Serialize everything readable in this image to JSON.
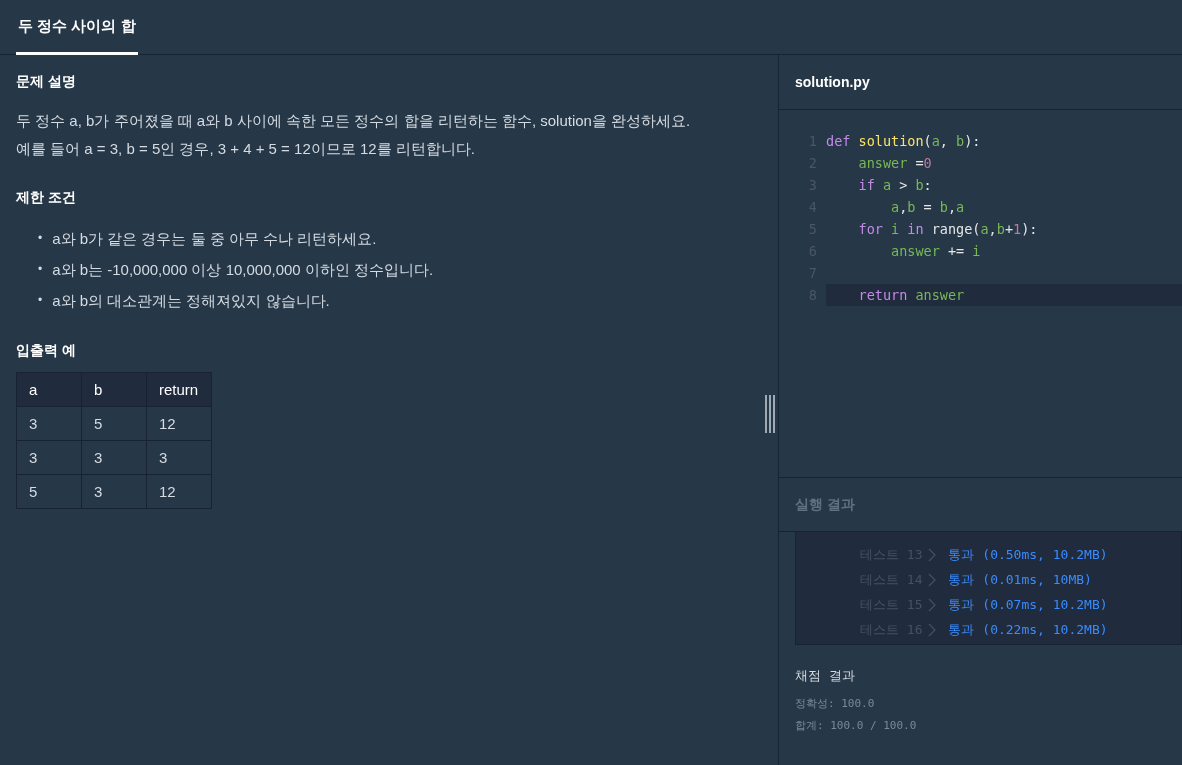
{
  "tabs": [
    {
      "label": "두 정수 사이의 합",
      "selected": true
    }
  ],
  "problem": {
    "sections": [
      {
        "kind": "text",
        "title": "문제 설명",
        "paragraphs": [
          "두 정수 a, b가 주어졌을 때 a와 b 사이에 속한 모든 정수의 합을 리턴하는 함수, solution을 완성하세요.",
          "예를 들어 a = 3, b = 5인 경우, 3 + 4 + 5 = 12이므로 12를 리턴합니다."
        ]
      },
      {
        "kind": "list",
        "title": "제한 조건",
        "bullet": "•",
        "items": [
          "a와 b가 같은 경우는 둘 중 아무 수나 리턴하세요.",
          "a와 b는 -10,000,000 이상 10,000,000 이하인 정수입니다.",
          "a와 b의 대소관계는 정해져있지 않습니다."
        ]
      },
      {
        "kind": "table",
        "title": "입출력 예",
        "columns": [
          "a",
          "b",
          "return"
        ],
        "rows": [
          [
            "3",
            "5",
            "12"
          ],
          [
            "3",
            "3",
            "3"
          ],
          [
            "5",
            "3",
            "12"
          ]
        ]
      }
    ]
  },
  "editor": {
    "filename": "solution.py",
    "lines": [
      {
        "number": "1",
        "current": false,
        "tokens": [
          {
            "text": "def ",
            "kind": "keyword"
          },
          {
            "text": "solution",
            "kind": "func"
          },
          {
            "text": "(",
            "kind": "plain"
          },
          {
            "text": "a",
            "kind": "var"
          },
          {
            "text": ", ",
            "kind": "plain"
          },
          {
            "text": "b",
            "kind": "var"
          },
          {
            "text": "):",
            "kind": "plain"
          }
        ]
      },
      {
        "number": "2",
        "current": false,
        "tokens": [
          {
            "text": "    answer",
            "kind": "var"
          },
          {
            "text": " =",
            "kind": "plain"
          },
          {
            "text": "0",
            "kind": "num"
          }
        ]
      },
      {
        "number": "3",
        "current": false,
        "tokens": [
          {
            "text": "    if ",
            "kind": "keyword"
          },
          {
            "text": "a",
            "kind": "var"
          },
          {
            "text": " > ",
            "kind": "plain"
          },
          {
            "text": "b",
            "kind": "var"
          },
          {
            "text": ":",
            "kind": "plain"
          }
        ]
      },
      {
        "number": "4",
        "current": false,
        "tokens": [
          {
            "text": "        a",
            "kind": "var"
          },
          {
            "text": ",",
            "kind": "plain"
          },
          {
            "text": "b",
            "kind": "var"
          },
          {
            "text": " = ",
            "kind": "plain"
          },
          {
            "text": "b",
            "kind": "var"
          },
          {
            "text": ",",
            "kind": "plain"
          },
          {
            "text": "a",
            "kind": "var"
          }
        ]
      },
      {
        "number": "5",
        "current": false,
        "tokens": [
          {
            "text": "    for ",
            "kind": "keyword"
          },
          {
            "text": "i",
            "kind": "var"
          },
          {
            "text": " in ",
            "kind": "keyword"
          },
          {
            "text": "range(",
            "kind": "plain"
          },
          {
            "text": "a",
            "kind": "var"
          },
          {
            "text": ",",
            "kind": "plain"
          },
          {
            "text": "b",
            "kind": "var"
          },
          {
            "text": "+",
            "kind": "plain"
          },
          {
            "text": "1",
            "kind": "num"
          },
          {
            "text": "):",
            "kind": "plain"
          }
        ]
      },
      {
        "number": "6",
        "current": false,
        "tokens": [
          {
            "text": "        answer",
            "kind": "var"
          },
          {
            "text": " += ",
            "kind": "plain"
          },
          {
            "text": "i",
            "kind": "var"
          }
        ]
      },
      {
        "number": "7",
        "current": false
      },
      {
        "number": "8",
        "current": true,
        "tokens": [
          {
            "text": "    return ",
            "kind": "keyword"
          },
          {
            "text": "answer",
            "kind": "var"
          }
        ]
      }
    ]
  },
  "results": {
    "title": "실행 결과",
    "tests": [
      {
        "label": "테스트 13",
        "passed": true,
        "result": "통과 (0.50ms, 10.2MB)"
      },
      {
        "label": "테스트 14",
        "passed": true,
        "result": "통과 (0.01ms, 10MB)"
      },
      {
        "label": "테스트 15",
        "passed": true,
        "result": "통과 (0.07ms, 10.2MB)"
      },
      {
        "label": "테스트 16",
        "passed": true,
        "result": "통과 (0.22ms, 10.2MB)"
      }
    ],
    "grading": {
      "title": "채점 결과",
      "lines": [
        "정확성: 100.0",
        "합계: 100.0 / 100.0"
      ]
    }
  }
}
